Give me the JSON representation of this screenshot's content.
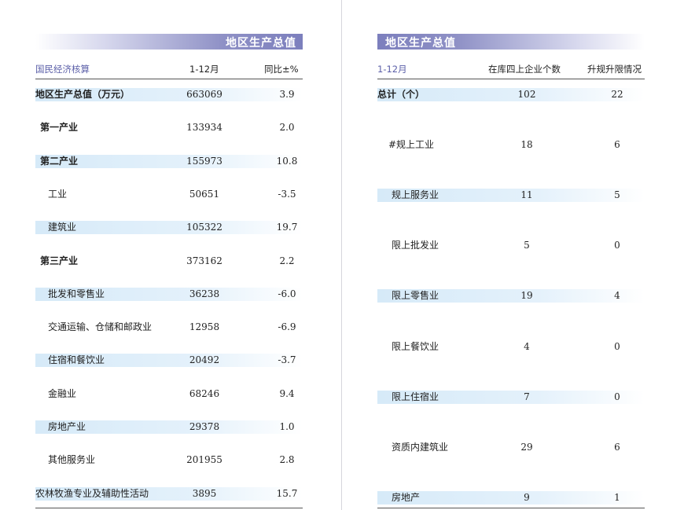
{
  "left": {
    "title": "地区生产总值",
    "headers": [
      "国民经济核算",
      "1-12月",
      "同比±%"
    ],
    "rows": [
      {
        "label": "地区生产总值（万元）",
        "value": "663069",
        "change": "3.9",
        "bold": true,
        "shaded": true
      },
      {
        "label": "第一产业",
        "value": "133934",
        "change": "2.0",
        "bold": true,
        "shaded": false
      },
      {
        "label": "第二产业",
        "value": "155973",
        "change": "10.8",
        "bold": true,
        "shaded": true
      },
      {
        "label": "工业",
        "value": "50651",
        "change": "-3.5",
        "bold": false,
        "shaded": false
      },
      {
        "label": "建筑业",
        "value": "105322",
        "change": "19.7",
        "bold": false,
        "shaded": true
      },
      {
        "label": "第三产业",
        "value": "373162",
        "change": "2.2",
        "bold": true,
        "shaded": false
      },
      {
        "label": "批发和零售业",
        "value": "36238",
        "change": "-6.0",
        "bold": false,
        "shaded": true
      },
      {
        "label": "交通运输、仓储和邮政业",
        "value": "12958",
        "change": "-6.9",
        "bold": false,
        "shaded": false
      },
      {
        "label": "住宿和餐饮业",
        "value": "20492",
        "change": "-3.7",
        "bold": false,
        "shaded": true
      },
      {
        "label": "金融业",
        "value": "68246",
        "change": "9.4",
        "bold": false,
        "shaded": false
      },
      {
        "label": "房地产业",
        "value": "29378",
        "change": "1.0",
        "bold": false,
        "shaded": true
      },
      {
        "label": "其他服务业",
        "value": "201955",
        "change": "2.8",
        "bold": false,
        "shaded": false
      },
      {
        "label": "农林牧渔专业及辅助性活动",
        "value": "3895",
        "change": "15.7",
        "bold": false,
        "shaded": true
      }
    ]
  },
  "right": {
    "title": "地区生产总值",
    "headers": [
      "1-12月",
      "在库四上企业个数",
      "升规升限情况"
    ],
    "rows": [
      {
        "label": "总计（个）",
        "count": "102",
        "upgraded": "22",
        "bold": true,
        "shaded": true
      },
      {
        "label": "#规上工业",
        "count": "18",
        "upgraded": "6",
        "bold": false,
        "shaded": false
      },
      {
        "label": "规上服务业",
        "count": "11",
        "upgraded": "5",
        "bold": false,
        "shaded": true
      },
      {
        "label": "限上批发业",
        "count": "5",
        "upgraded": "0",
        "bold": false,
        "shaded": false
      },
      {
        "label": "限上零售业",
        "count": "19",
        "upgraded": "4",
        "bold": false,
        "shaded": true
      },
      {
        "label": "限上餐饮业",
        "count": "4",
        "upgraded": "0",
        "bold": false,
        "shaded": false
      },
      {
        "label": "限上住宿业",
        "count": "7",
        "upgraded": "0",
        "bold": false,
        "shaded": true
      },
      {
        "label": "资质内建筑业",
        "count": "29",
        "upgraded": "6",
        "bold": false,
        "shaded": false
      },
      {
        "label": "房地产",
        "count": "9",
        "upgraded": "1",
        "bold": false,
        "shaded": true
      }
    ]
  },
  "colors": {
    "title_bar": "#7c7fbd",
    "header_text": "#5b5fa8",
    "row_shade": "#d6eaf8"
  }
}
